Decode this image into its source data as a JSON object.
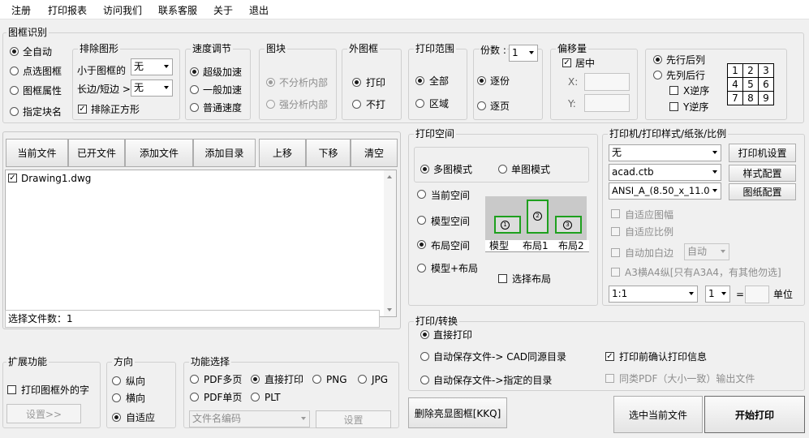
{
  "menu": [
    "注册",
    "打印报表",
    "访问我们",
    "联系客服",
    "关于",
    "退出"
  ],
  "recognition": {
    "title": "图框识别",
    "modes": [
      "全自动",
      "点选图框",
      "图框属性",
      "指定块名"
    ],
    "selected": "全自动"
  },
  "exclude": {
    "title": "排除图形",
    "smaller_label": "小于图框的",
    "smaller_value": "无",
    "ratio_label": "长边/短边 >",
    "ratio_value": "无",
    "square_label": "排除正方形",
    "square_checked": true
  },
  "speed": {
    "title": "速度调节",
    "options": [
      "超级加速",
      "一般加速",
      "普通速度"
    ],
    "selected": "超级加速"
  },
  "block": {
    "title": "图块",
    "options": [
      "不分析内部",
      "强分析内部"
    ]
  },
  "outer_frame": {
    "title": "外图框",
    "options": [
      "打印",
      "不打"
    ],
    "selected": "打印"
  },
  "print_range": {
    "title": "打印范围",
    "options": [
      "全部",
      "区域"
    ],
    "selected": "全部"
  },
  "copies": {
    "label": "份数 :",
    "value": "1",
    "options": [
      "逐份",
      "逐页"
    ],
    "selected": "逐份"
  },
  "offset": {
    "title": "偏移量",
    "center_label": "居中",
    "center_checked": true,
    "x_label": "X:",
    "y_label": "Y:"
  },
  "order": {
    "options": [
      "先行后列",
      "先列后行"
    ],
    "selected": "先行后列",
    "x_reverse": "X逆序",
    "y_reverse": "Y逆序",
    "grid": [
      "1",
      "2",
      "3",
      "4",
      "5",
      "6",
      "7",
      "8",
      "9"
    ]
  },
  "file_toolbar": [
    "当前文件",
    "已开文件",
    "添加文件",
    "添加目录",
    "上移",
    "下移",
    "清空"
  ],
  "file_list": [
    {
      "name": "Drawing1.dwg",
      "checked": true
    }
  ],
  "file_count": "选择文件数：1",
  "print_space": {
    "title": "打印空间",
    "modes": [
      "多图模式",
      "单图模式"
    ],
    "mode_selected": "多图模式",
    "spaces": [
      "当前空间",
      "模型空间",
      "布局空间",
      "模型+布局"
    ],
    "space_selected": "布局空间",
    "tabs": [
      "模型",
      "布局1",
      "布局2"
    ],
    "select_layout": "选择布局"
  },
  "printer": {
    "title": "打印机/打印样式/纸张/比例",
    "printer_value": "无",
    "printer_button": "打印机设置",
    "style_value": "acad.ctb",
    "style_button": "样式配置",
    "paper_value": "ANSI_A_(8.50_x_11.0",
    "paper_button": "图纸配置",
    "adapt_frame": "自适应图幅",
    "adapt_scale": "自适应比例",
    "auto_margin": "自动加白边",
    "auto_margin_value": "自动",
    "a3_note": "A3横A4纵[只有A3A4，有其他勿选]",
    "scale_value": "1:1",
    "unit_value": "1",
    "eq": "=",
    "unit_label": "单位"
  },
  "print_convert": {
    "title": "打印/转换",
    "options": [
      "直接打印",
      "自动保存文件-> CAD同源目录",
      "自动保存文件->指定的目录"
    ],
    "selected": "直接打印",
    "confirm_label": "打印前确认打印信息",
    "confirm_checked": true,
    "same_pdf_label": "同类PDF（大小一致）输出文件"
  },
  "extension": {
    "title": "扩展功能",
    "print_outside_text": "打印图框外的字",
    "settings_button": "设置>>"
  },
  "direction": {
    "title": "方向",
    "options": [
      "纵向",
      "横向",
      "自适应"
    ],
    "selected": "自适应"
  },
  "function": {
    "title": "功能选择",
    "options_row1": [
      "PDF多页",
      "直接打印",
      "PNG",
      "JPG"
    ],
    "options_row2": [
      "PDF单页",
      "PLT"
    ],
    "selected": "直接打印",
    "encoding_value": "文件名编码",
    "settings_button": "设置"
  },
  "actions": {
    "remove_highlight": "删除亮显图框[KKQ]",
    "select_current": "选中当前文件",
    "start_print": "开始打印"
  }
}
